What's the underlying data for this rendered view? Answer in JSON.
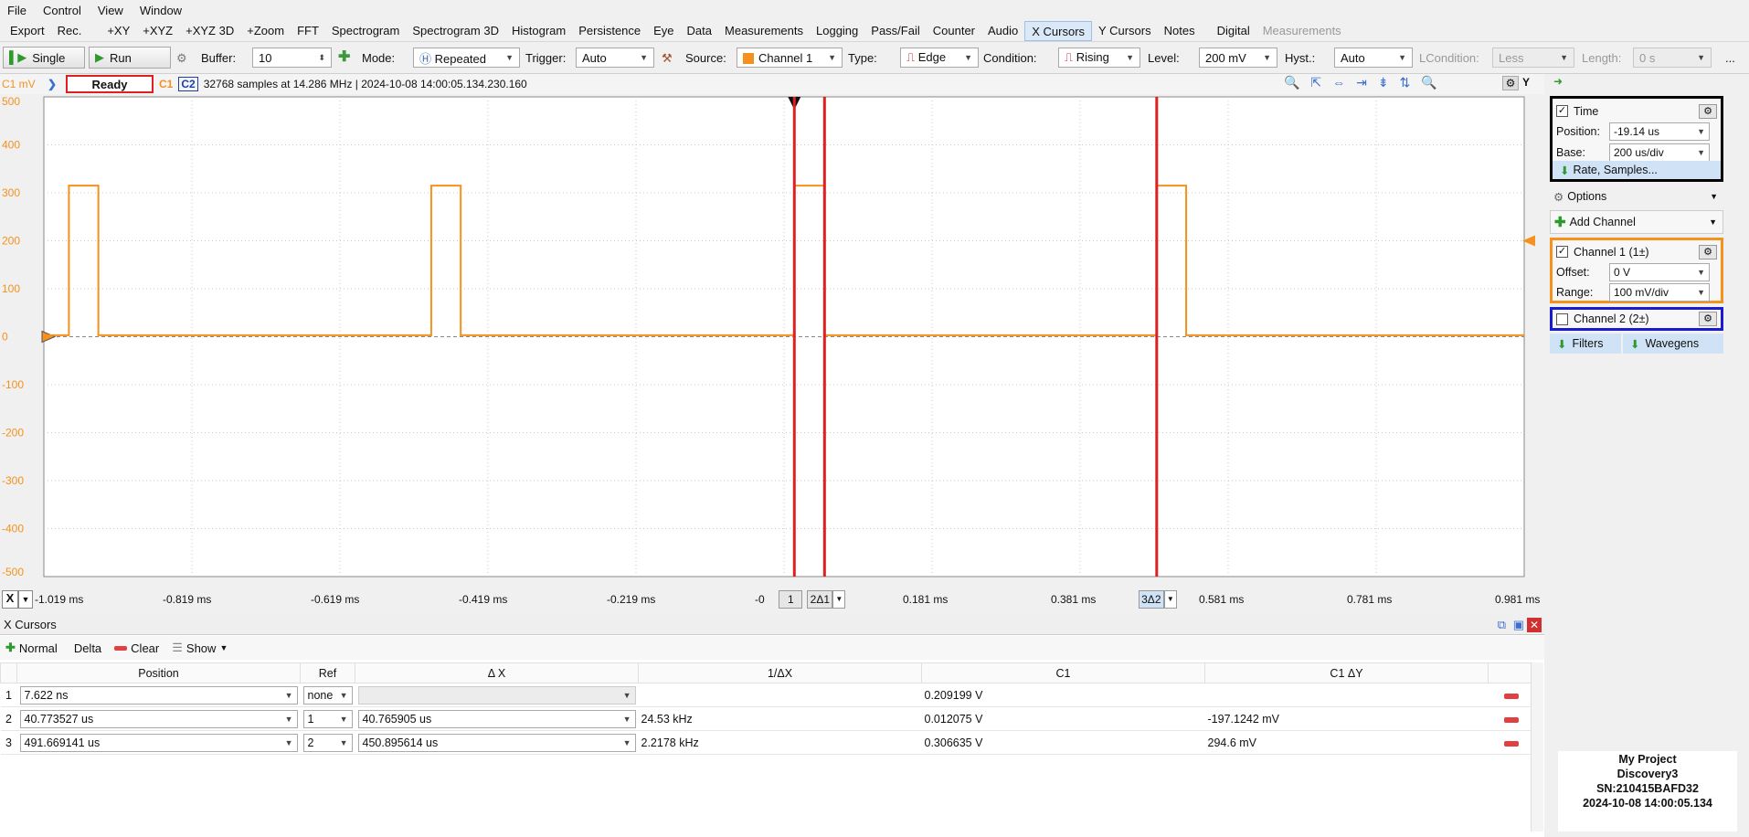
{
  "menu": [
    "File",
    "Control",
    "View",
    "Window"
  ],
  "tabs": [
    "Export",
    "Rec.",
    "+XY",
    "+XYZ",
    "+XYZ 3D",
    "+Zoom",
    "FFT",
    "Spectrogram",
    "Spectrogram 3D",
    "Histogram",
    "Persistence",
    "Eye",
    "Data",
    "Measurements",
    "Logging",
    "Pass/Fail",
    "Counter",
    "Audio",
    "X Cursors",
    "Y Cursors",
    "Notes",
    "Digital",
    "Measurements"
  ],
  "active_tab": "X Cursors",
  "toolbar": {
    "single": "Single",
    "run": "Run",
    "buffer_label": "Buffer:",
    "buffer_value": "10",
    "mode_label": "Mode:",
    "mode_value": "Repeated",
    "trigger_label": "Trigger:",
    "trigger_value": "Auto",
    "source_label": "Source:",
    "source_value": "Channel 1",
    "type_label": "Type:",
    "type_value": "Edge",
    "condition_label": "Condition:",
    "condition_value": "Rising",
    "level_label": "Level:",
    "level_value": "200 mV",
    "hyst_label": "Hyst.:",
    "hyst_value": "Auto",
    "lcondition_label": "LCondition:",
    "lcondition_value": "Less",
    "length_label": "Length:",
    "length_value": "0 s",
    "more": "..."
  },
  "status": {
    "c1_unit": "C1 mV",
    "state": "Ready",
    "c1": "C1",
    "c2": "C2",
    "info": "32768 samples at 14.286 MHz  |  2024-10-08 14:00:05.134.230.160"
  },
  "plot": {
    "y_ticks": [
      "500",
      "400",
      "300",
      "200",
      "100",
      "0",
      "-100",
      "-200",
      "-300",
      "-400",
      "-500"
    ],
    "x_ticks": [
      "-1.019 ms",
      "-0.819 ms",
      "-0.619 ms",
      "-0.419 ms",
      "-0.219 ms",
      "-0",
      "0.181 ms",
      "0.381 ms",
      "0.581 ms",
      "0.781 ms",
      "0.981 ms"
    ],
    "x_prefix": "X",
    "cursor_labels": [
      "1",
      "2Δ1",
      "3Δ2"
    ],
    "signal_color": "#f5911e",
    "cursor_color": "#e02020",
    "x_range_ms": [
      -1.019,
      0.991
    ],
    "y_range_mV": [
      -500,
      500
    ],
    "pulses_ms": [
      [
        -0.985,
        -0.945
      ],
      [
        -0.493,
        -0.453
      ],
      [
        0.0,
        0.041
      ],
      [
        0.492,
        0.532
      ]
    ],
    "pulse_level_mV": 315,
    "cursors_ms": [
      0.0,
      0.041,
      0.492
    ]
  },
  "right_panel": {
    "time_title": "Time",
    "position_label": "Position:",
    "position_value": "-19.14 us",
    "base_label": "Base:",
    "base_value": "200 us/div",
    "rate_samples": "Rate, Samples...",
    "options": "Options",
    "add_channel": "Add Channel",
    "ch1_title": "Channel 1 (1±)",
    "offset_label": "Offset:",
    "offset_value": "0 V",
    "range_label": "Range:",
    "range_value": "100 mV/div",
    "ch2_title": "Channel 2 (2±)",
    "filters": "Filters",
    "wavegens": "Wavegens"
  },
  "xcursors": {
    "title": "X Cursors",
    "normal": "Normal",
    "delta": "Delta",
    "clear": "Clear",
    "show": "Show",
    "headers": [
      "Position",
      "Ref",
      "Δ X",
      "1/ΔX",
      "C1",
      "C1 ΔY"
    ],
    "rows": [
      {
        "idx": "1",
        "position": "7.622 ns",
        "ref": "none",
        "dx": "",
        "inv": "",
        "c1": "0.209199 V",
        "c1dy": ""
      },
      {
        "idx": "2",
        "position": "40.773527 us",
        "ref": "1",
        "dx": "40.765905 us",
        "inv": "24.53 kHz",
        "c1": "0.012075 V",
        "c1dy": "-197.1242 mV"
      },
      {
        "idx": "3",
        "position": "491.669141 us",
        "ref": "2",
        "dx": "450.895614 us",
        "inv": "2.2178 kHz",
        "c1": "0.306635 V",
        "c1dy": "294.6 mV"
      }
    ]
  },
  "device": {
    "project": "My Project",
    "name": "Discovery3",
    "sn": "SN:210415BAFD32",
    "time": "2024-10-08 14:00:05.134"
  }
}
